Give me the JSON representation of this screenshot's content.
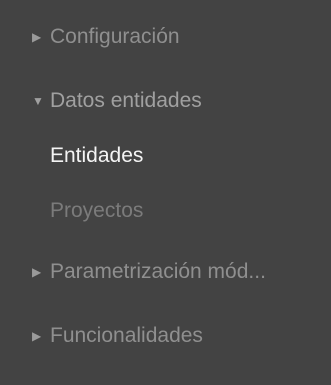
{
  "sidebar": {
    "items": [
      {
        "label": "Configuración",
        "caret": "▶",
        "icon": "caret-right-icon"
      },
      {
        "label": "Datos entidades",
        "caret": "▼",
        "icon": "caret-down-icon",
        "children": [
          {
            "label": "Entidades",
            "active": true
          },
          {
            "label": "Proyectos",
            "active": false
          }
        ]
      },
      {
        "label": "Parametrización mód...",
        "caret": "▶",
        "icon": "caret-right-icon"
      },
      {
        "label": "Funcionalidades",
        "caret": "▶",
        "icon": "caret-right-icon"
      }
    ]
  },
  "colors": {
    "background": "#434343",
    "active_text": "#f4f4f4",
    "inactive_text": "#8f8f8f",
    "sub_inactive_text": "#7b7b7b"
  }
}
